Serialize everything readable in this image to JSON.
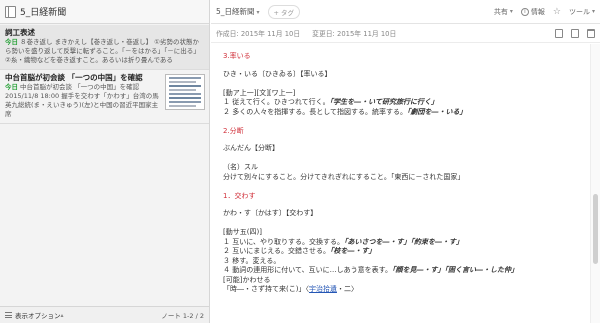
{
  "notebook": {
    "title": "5_日経新聞"
  },
  "notes": [
    {
      "title": "詞工表述",
      "date": "今日",
      "snippet": "８巻き返し まきかえし【巻き返し・巻返し】 ①劣勢の状態から勢いを盛り返して反撃に転ずること。「－をはかる」「－に出る」②糸・織物などを巻き返すこと。あるいは折り畳んである"
    },
    {
      "title": "中台首脳が初会談 「一つの中国」を確認",
      "date": "今日",
      "snippet": "中台首脳が初会談 「一つの中国」を確認 2015/11/8 18:00 握手を交わす「かわす」台湾の馬英九総統(ま・えいきゅう)(左)と中国の習近平国家主席"
    }
  ],
  "left_footer": {
    "view_options": "表示オプション",
    "note_count": "ノート 1-2 / 2"
  },
  "toolbar": {
    "notebook": "5_日経新聞",
    "tag_placeholder": "+ タグ",
    "share": "共有",
    "info": "情報",
    "tools": "ツール"
  },
  "meta": {
    "created": "作成日: 2015年 11月 10日",
    "modified": "変更日: 2015年 11月 10日"
  },
  "content": {
    "s1": "3.率いる",
    "s1_reading": "ひき・いる〔ひきゐる〕【率いる】",
    "s1_gram": "[動ア上一][文][ワ上一]",
    "s1_l1_a": "１ 従えて行く。ひきつれて行く。",
    "s1_l1_ex": "「学生を―・いて研究旅行に行く」",
    "s1_l2_a": "２ 多くの人々を指揮する。長として指図する。統率する。",
    "s1_l2_ex": "「劇団を―・いる」",
    "s2": "2.分断",
    "s2_reading": "ぶんだん【分断】",
    "s2_gram": "（名）スル",
    "s2_l1": "分けて別々にすること。分けてきれぎれにすること。「東西に－された国家」",
    "s3": "1．交わす",
    "s3_reading": "かわ・す〔かはす〕【交わす】",
    "s3_gram": "[動サ五(四)]",
    "s3_l1_a": "１ 互いに、やり取りする。交換する。",
    "s3_l1_ex": "「あいさつを―・す」「約束を―・す」",
    "s3_l2_a": "２ 互いにまじえる。交錯させる。",
    "s3_l2_ex": "「枝を―・す」",
    "s3_l3": "３ 移す。変える。",
    "s3_l4_a": "４ 動詞の連用形に付いて、互いに…しあう意を表す。",
    "s3_l4_ex": "「顔を見―・す」「固く言い―・した仲」",
    "s3_kanou": "[可能]かわせる",
    "s3_quote_a": "「時―・さず持て来(こ)」〈",
    "s3_quote_link": "宇治拾遺",
    "s3_quote_b": "・二〉"
  }
}
